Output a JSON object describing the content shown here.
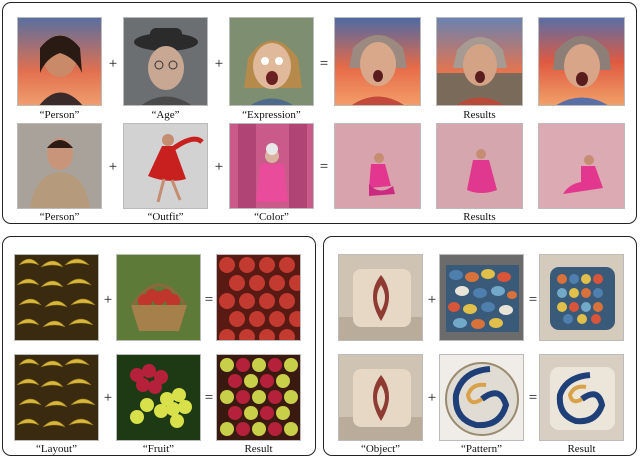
{
  "top": {
    "row1": {
      "captions": [
        "“Person”",
        "“Age”",
        "“Expression”"
      ],
      "result_caption": "Results",
      "operators": [
        "+",
        "+",
        "="
      ]
    },
    "row2": {
      "captions": [
        "“Person”",
        "“Outfit”",
        "“Color”"
      ],
      "result_caption": "Results",
      "operators": [
        "+",
        "+",
        "="
      ]
    }
  },
  "bottom_left": {
    "row1": {
      "operators": [
        "+",
        "="
      ]
    },
    "row2": {
      "operators": [
        "+",
        "="
      ]
    },
    "captions": [
      "“Layout”",
      "“Fruit”",
      "Result"
    ]
  },
  "bottom_right": {
    "row1": {
      "operators": [
        "+",
        "="
      ]
    },
    "row2": {
      "operators": [
        "+",
        "="
      ]
    },
    "captions": [
      "“Object”",
      "“Pattern”",
      "Result"
    ]
  },
  "colors": {
    "sunset_sky": "#e2704f",
    "pink_backdrop": "#d9a3ad",
    "banana": "#d8b83a",
    "apple": "#b8332b",
    "pillow_red": "#8e3b33",
    "pebble_blue": "#4f7fae"
  }
}
